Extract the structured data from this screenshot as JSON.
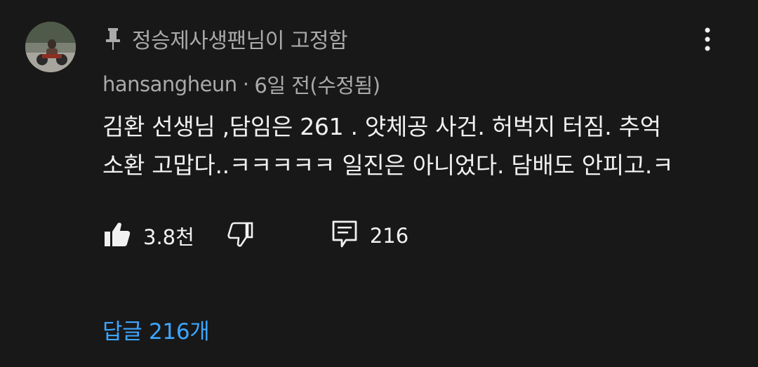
{
  "comment": {
    "pinned_label": "정승제사생팬님이 고정함",
    "author": "hansangheun",
    "separator": "·",
    "timestamp": "6일 전(수정됨)",
    "text_line1": "김환 선생님 ,담임은 261 . 얏체공 사건. 허벅지 터짐. 추억",
    "text_line2": "소환 고맙다..ㅋㅋㅋㅋㅋ 일진은 아니었다. 담배도 안피고.ㅋ",
    "like_count": "3.8천",
    "reply_count": "216",
    "replies_link_label": "답글 216개"
  },
  "icons": {
    "pin": "pin-icon",
    "more": "more-vert-icon",
    "like": "thumb-up-icon",
    "dislike": "thumb-down-icon",
    "reply": "comment-icon"
  },
  "colors": {
    "background": "#181818",
    "primary_text": "#f1f1f1",
    "secondary_text": "#aaaaaa",
    "link": "#3ea6ff"
  }
}
